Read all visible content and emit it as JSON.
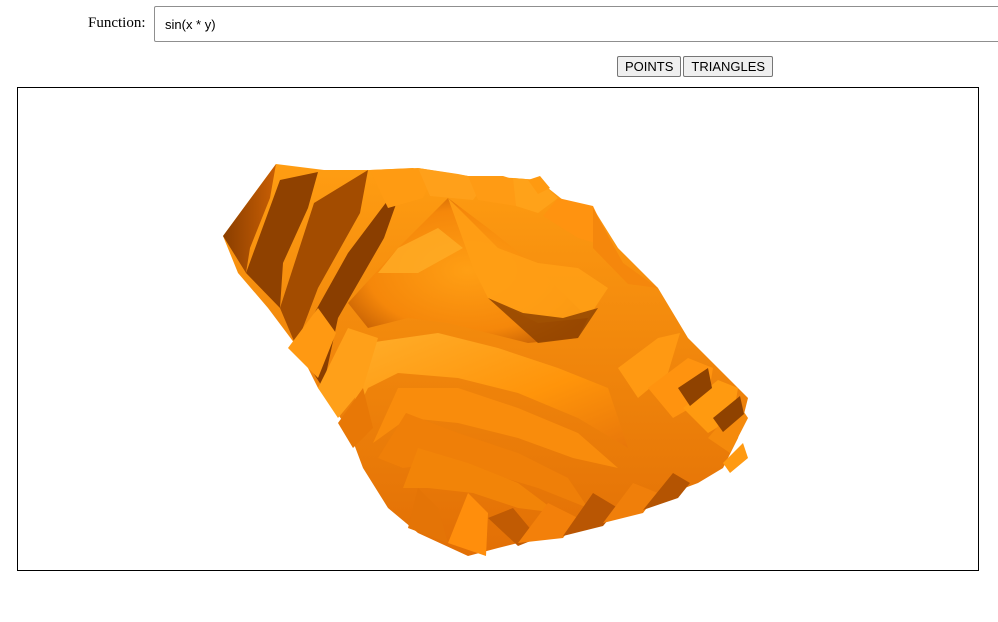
{
  "function_row": {
    "label": "Function:",
    "input_value": "sin(x * y)"
  },
  "buttons": {
    "points_label": "POINTS",
    "triangles_label": "TRIANGLES"
  },
  "plot": {
    "surface_light": "#ff9a0f",
    "surface_mid": "#f07c0a",
    "surface_dark": "#8a3e00"
  }
}
